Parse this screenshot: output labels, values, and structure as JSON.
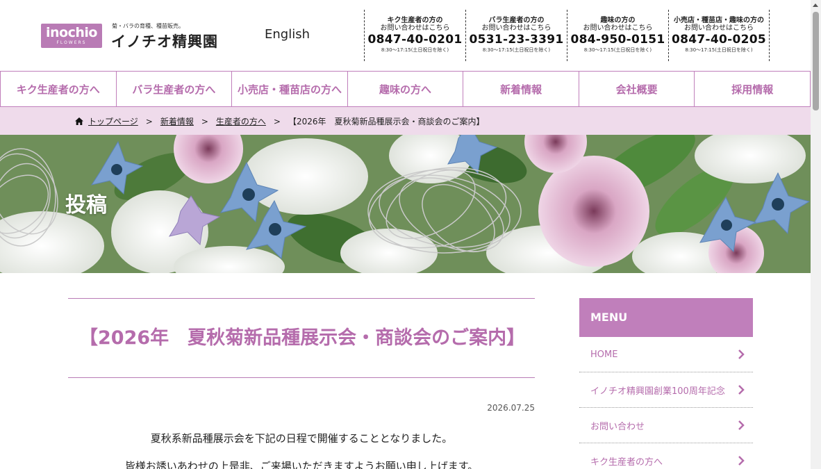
{
  "logo": {
    "main": "inochio",
    "sub": "FLOWERS"
  },
  "company": {
    "tagline": "菊・バラの育種、種苗販売。",
    "name": "イノチオ精興園"
  },
  "language_link": "English",
  "contacts": [
    {
      "title": "キク生産者の方の",
      "subtitle": "お問い合わせはこちら",
      "phone": "0847-40-0201",
      "hours": "8:30〜17:15(土日祝日を除く)"
    },
    {
      "title": "バラ生産者の方の",
      "subtitle": "お問い合わせはこちら",
      "phone": "0531-23-3391",
      "hours": "8:30〜17:15(土日祝日を除く)"
    },
    {
      "title": "趣味の方の",
      "subtitle": "お問い合わせはこちら",
      "phone": "084-950-0151",
      "hours": "8:30〜17:15(土日祝日を除く)"
    },
    {
      "title": "小売店・種苗店・趣味の方の",
      "subtitle": "お問い合わせはこちら",
      "phone": "0847-40-0205",
      "hours": "8:30〜17:15(土日祝日を除く)"
    }
  ],
  "nav": [
    "キク生産者の方へ",
    "バラ生産者の方へ",
    "小売店・種苗店の方へ",
    "趣味の方へ",
    "新着情報",
    "会社概要",
    "採用情報"
  ],
  "breadcrumb": {
    "home": "トップページ",
    "items": [
      "新着情報",
      "生産者の方へ"
    ],
    "current": "【2026年　夏秋菊新品種展示会・商談会のご案内】",
    "separator": ">"
  },
  "hero": {
    "title": "投稿"
  },
  "article": {
    "title": "【2026年　夏秋菊新品種展示会・商談会のご案内】",
    "date": "2026.07.25",
    "paragraphs": [
      "夏秋系新品種展示会を下記の日程で開催することとなりました。",
      "皆様お誘いあわせの上是非、ご来場いただきますようお願い申し上げます。"
    ]
  },
  "sidebar": {
    "heading": "MENU",
    "items": [
      "HOME",
      "イノチオ精興園創業100周年記念",
      "お問い合わせ",
      "キク生産者の方へ"
    ]
  },
  "colors": {
    "accent": "#c07fbb",
    "accent_text": "#b56cac",
    "breadcrumb_bg": "#efdbeb"
  }
}
